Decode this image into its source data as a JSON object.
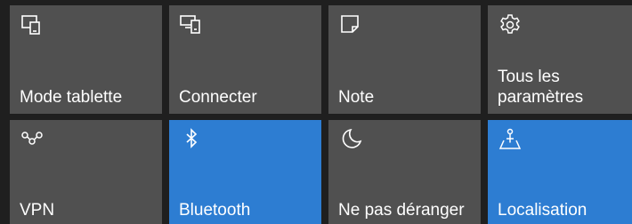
{
  "action_center": {
    "colors": {
      "background": "#1f1f1f",
      "tile_off": "#505050",
      "tile_on": "#2d7dd2",
      "text": "#ffffff"
    },
    "tiles": [
      {
        "label": "Mode tablette",
        "icon": "tablet-mode-icon",
        "active": false
      },
      {
        "label": "Connecter",
        "icon": "connect-icon",
        "active": false
      },
      {
        "label": "Note",
        "icon": "note-icon",
        "active": false
      },
      {
        "label": "Tous les paramètres",
        "icon": "gear-icon",
        "active": false
      },
      {
        "label": "VPN",
        "icon": "vpn-icon",
        "active": false
      },
      {
        "label": "Bluetooth",
        "icon": "bluetooth-icon",
        "active": true
      },
      {
        "label": "Ne pas déranger",
        "icon": "moon-icon",
        "active": false
      },
      {
        "label": "Localisation",
        "icon": "location-icon",
        "active": true
      }
    ]
  }
}
